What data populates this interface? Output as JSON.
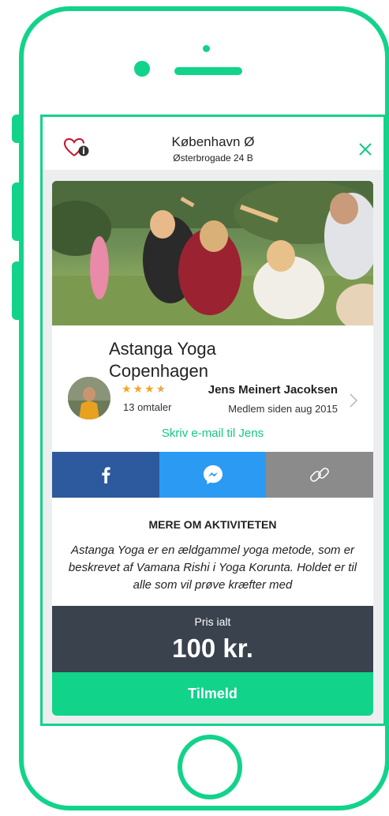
{
  "header": {
    "location": "København Ø",
    "address": "Østerbrogade 24 B"
  },
  "activity": {
    "title": "Astanga Yoga Copenhagen",
    "rating": 3.5,
    "rating_max": 5,
    "reviews": "13 omtaler"
  },
  "host": {
    "name": "Jens Meinert Jacoksen",
    "member_since": "Medlem siden aug 2015",
    "email_link": "Skriv e-mail til Jens"
  },
  "about": {
    "heading": "MERE OM AKTIVITETEN",
    "text": "Astanga Yoga er en ældgammel yoga metode, som er beskrevet af Vamana Rishi i Yoga Korunta. Holdet er til alle som vil prøve kræfter med"
  },
  "price": {
    "label": "Pris ialt",
    "value": "100 kr."
  },
  "signup_label": "Tilmeld",
  "colors": {
    "accent": "#12d38a",
    "facebook": "#2d5a9e",
    "messenger": "#2b9af3",
    "link": "#8b8b8b",
    "price_bar": "#3a424e"
  },
  "icons": [
    "heart-info-icon",
    "close-icon",
    "chevron-right-icon",
    "facebook-icon",
    "messenger-icon",
    "link-icon"
  ]
}
